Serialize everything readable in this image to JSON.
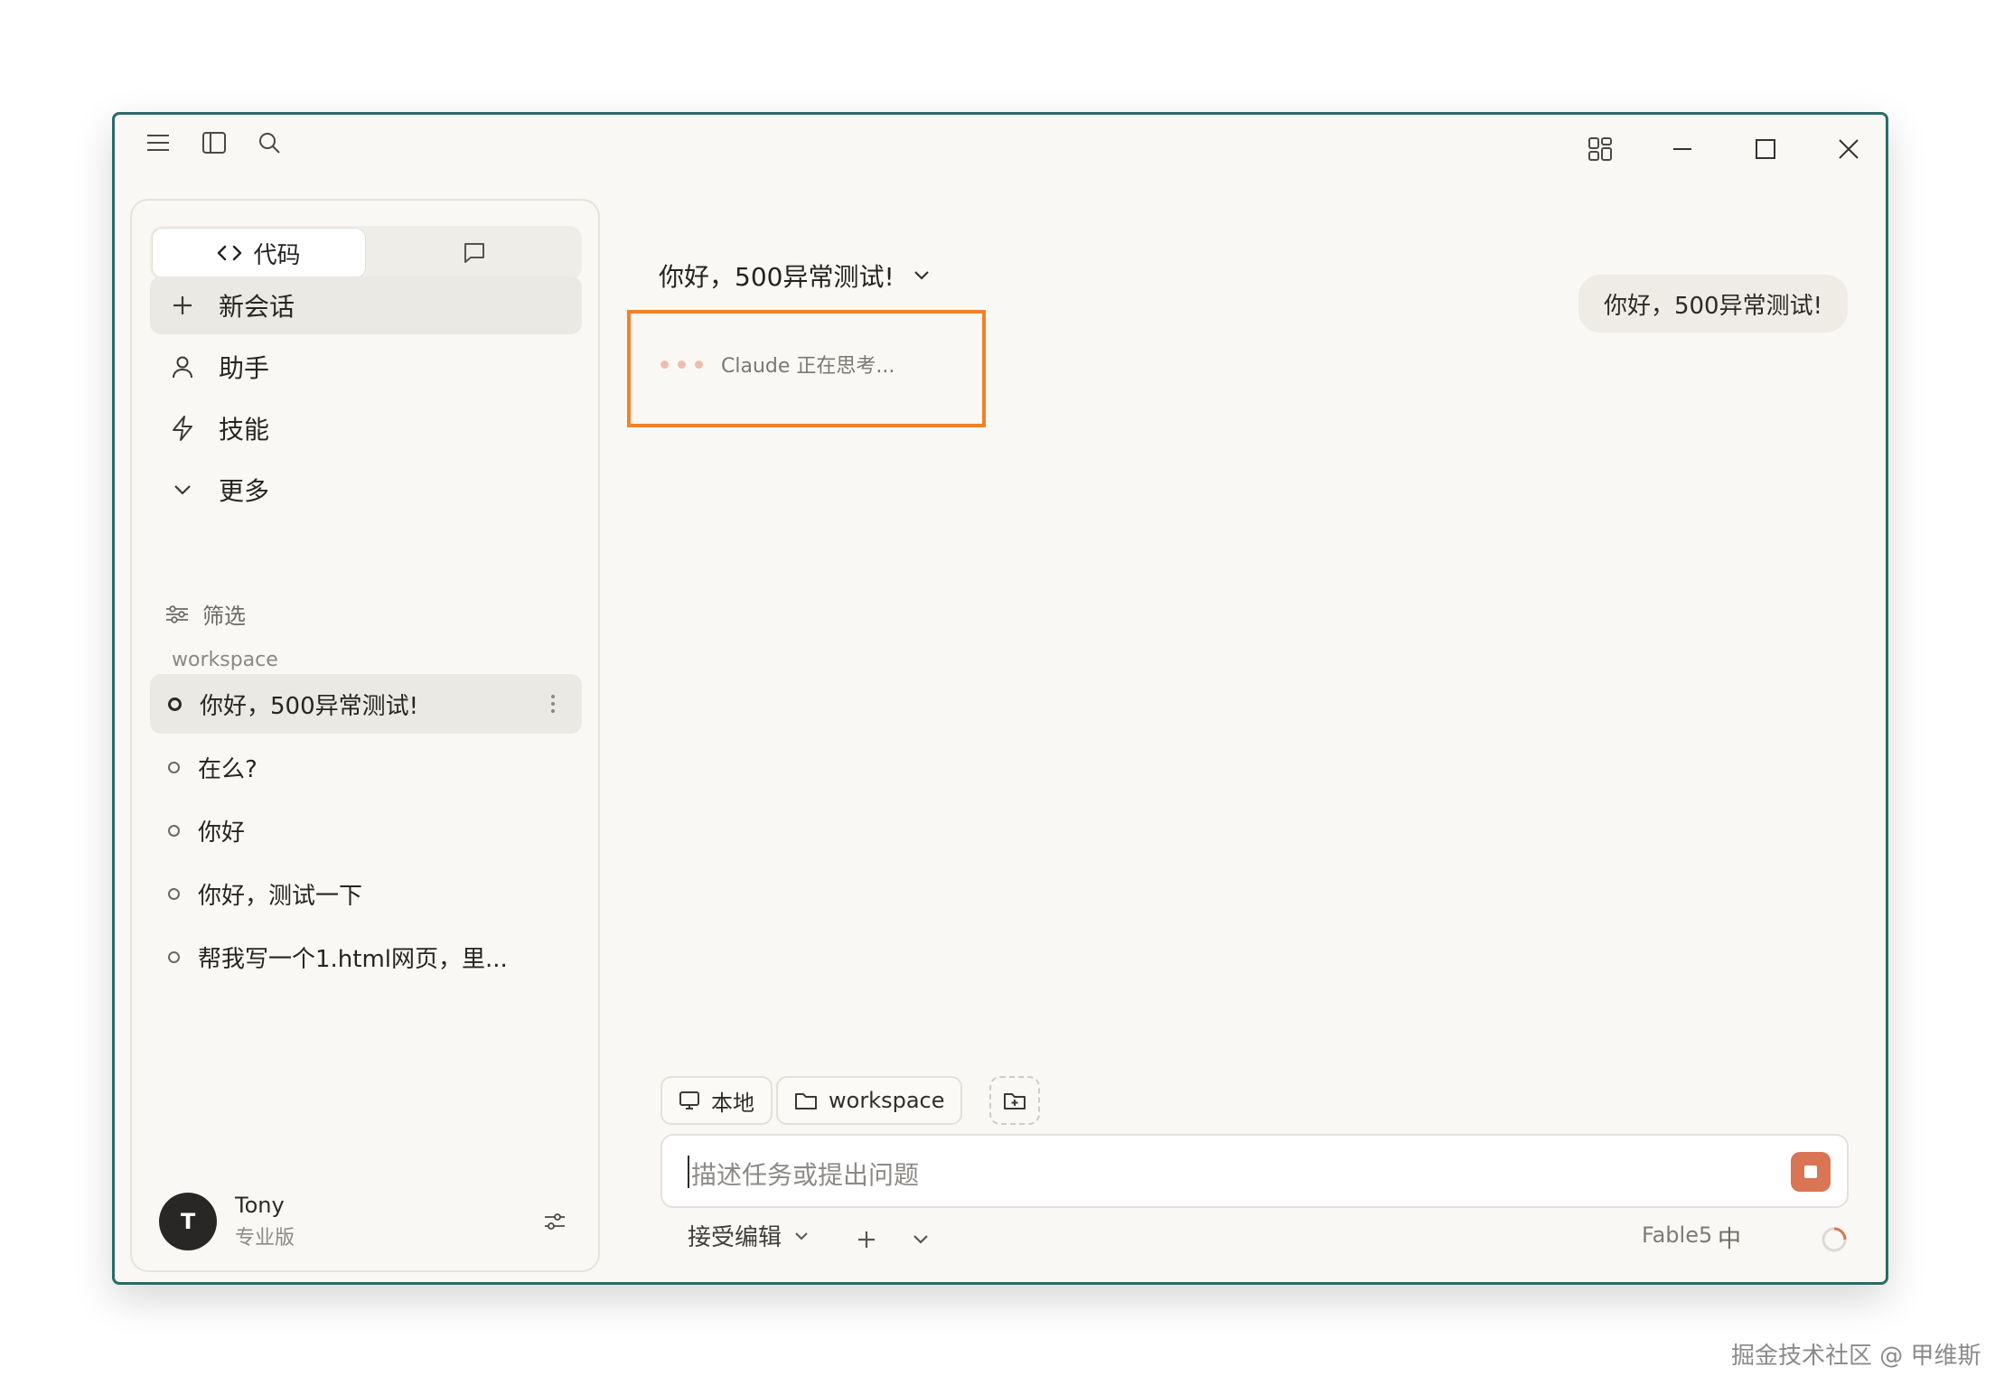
{
  "titlebar": {
    "menu_icon": "menu-icon",
    "sidebar_icon": "sidebar-toggle-icon",
    "search_icon": "search-icon",
    "layout_icon": "layout-grid-icon",
    "minimize_icon": "minimize-icon",
    "maximize_icon": "maximize-icon",
    "close_icon": "close-icon"
  },
  "sidebar": {
    "tabs": {
      "code_label": "代码",
      "chat_icon": "chat-icon"
    },
    "nav": [
      {
        "label": "新会话",
        "icon": "plus-icon"
      },
      {
        "label": "助手",
        "icon": "person-icon"
      },
      {
        "label": "技能",
        "icon": "lightning-icon"
      },
      {
        "label": "更多",
        "icon": "chevron-down-icon"
      }
    ],
    "filter_label": "筛选",
    "section_label": "workspace",
    "conversations": [
      {
        "title": "你好，500异常测试!"
      },
      {
        "title": "在么?"
      },
      {
        "title": "你好"
      },
      {
        "title": "你好，测试一下"
      },
      {
        "title": "帮我写一个1.html网页，里..."
      }
    ],
    "user": {
      "initial": "T",
      "name": "Tony",
      "plan": "专业版"
    }
  },
  "main": {
    "conversation_title": "你好，500异常测试!",
    "user_message": "你好，500异常测试!",
    "thinking_text": "Claude 正在思考...",
    "chips": {
      "local_label": "本地",
      "workspace_label": "workspace"
    },
    "input_placeholder": "描述任务或提出问题",
    "mode_label": "接受编辑",
    "model_label": "Fable5",
    "lang_label": "中"
  },
  "colors": {
    "window_border": "#2a6b68",
    "highlight_box": "#f0822a",
    "stop_button": "#d97455",
    "thinking_dots": "#f0bcb0"
  },
  "watermark": "掘金技术社区 @ 甲维斯"
}
